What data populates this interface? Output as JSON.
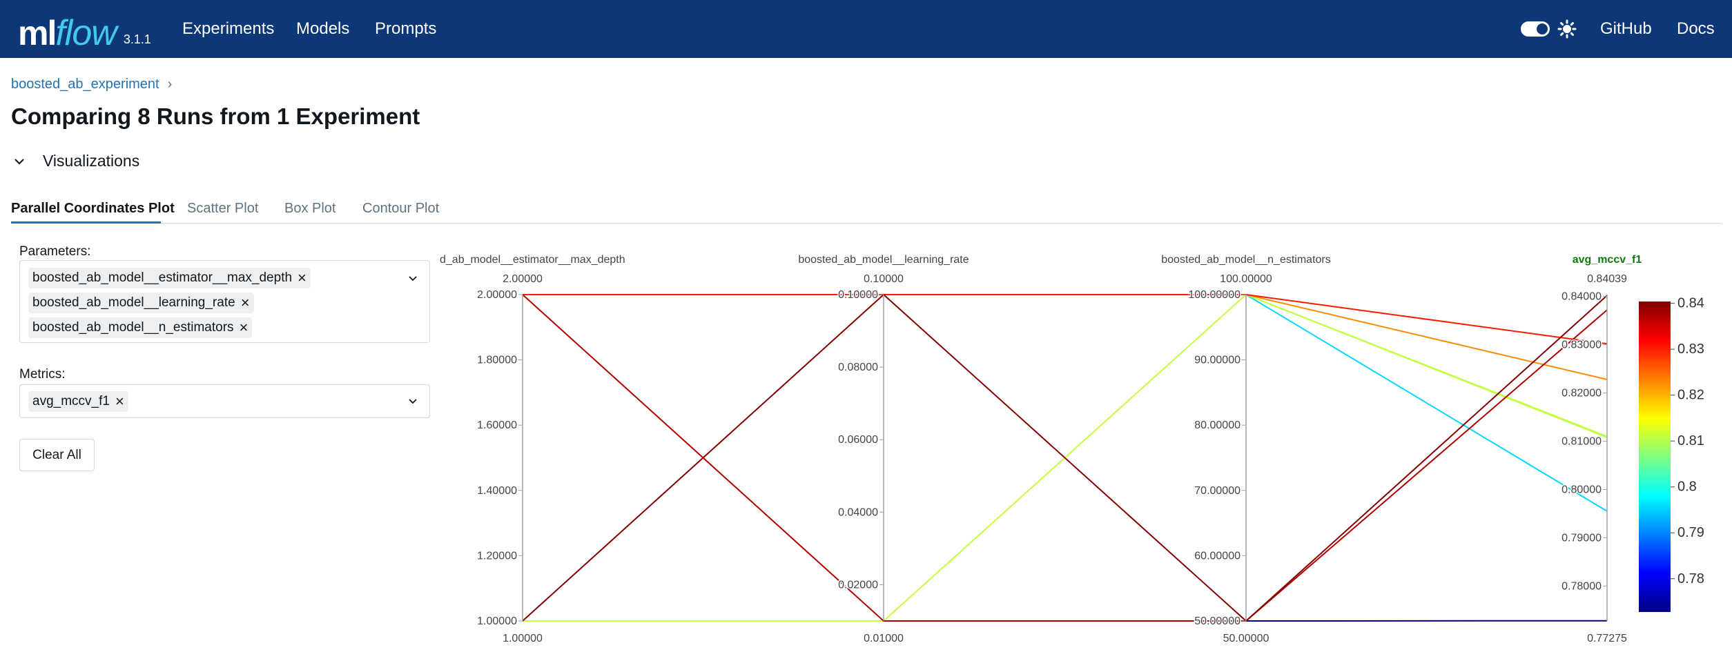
{
  "header": {
    "logo_main": "ml",
    "logo_accent": "flow",
    "version": "3.1.1",
    "nav": [
      "Experiments",
      "Models",
      "Prompts"
    ],
    "right_links": [
      "GitHub",
      "Docs"
    ],
    "colors": {
      "bar": "#0e3778",
      "accent": "#43c9ed"
    }
  },
  "breadcrumb": {
    "experiment": "boosted_ab_experiment",
    "separator": "›"
  },
  "page": {
    "title": "Comparing 8 Runs from 1 Experiment"
  },
  "section": {
    "title": "Visualizations"
  },
  "tabs": [
    "Parallel Coordinates Plot",
    "Scatter Plot",
    "Box Plot",
    "Contour Plot"
  ],
  "controls": {
    "parameters_label": "Parameters:",
    "parameters": [
      "boosted_ab_model__estimator__max_depth",
      "boosted_ab_model__learning_rate",
      "boosted_ab_model__n_estimators"
    ],
    "metrics_label": "Metrics:",
    "metrics": [
      "avg_mccv_f1"
    ],
    "clear_all": "Clear All"
  },
  "chart_data": {
    "type": "parallel_coordinates",
    "dimensions": [
      {
        "label": "d_ab_model__estimator__max_depth",
        "range": [
          1,
          2
        ],
        "top_label": "2.00000",
        "bottom_label": "1.00000",
        "ticks": [
          "2.00000",
          "1.80000",
          "1.60000",
          "1.40000",
          "1.20000",
          "1.00000"
        ]
      },
      {
        "label": "boosted_ab_model__learning_rate",
        "range": [
          0.01,
          0.1
        ],
        "top_label": "0.10000",
        "bottom_label": "0.01000",
        "ticks": [
          "0.10000",
          "0.08000",
          "0.06000",
          "0.04000",
          "0.02000"
        ]
      },
      {
        "label": "boosted_ab_model__n_estimators",
        "range": [
          50,
          100
        ],
        "top_label": "100.00000",
        "bottom_label": "50.00000",
        "ticks": [
          "100.00000",
          "90.00000",
          "80.00000",
          "70.00000",
          "60.00000",
          "50.00000"
        ]
      },
      {
        "label": "avg_mccv_f1",
        "range": [
          0.77275,
          0.84039
        ],
        "top_label": "0.84039",
        "bottom_label": "0.77275",
        "ticks": [
          "0.84000",
          "0.83000",
          "0.82000",
          "0.81000",
          "0.80000",
          "0.79000",
          "0.78000"
        ]
      }
    ],
    "runs": [
      [
        2,
        0.1,
        100,
        0.8302
      ],
      [
        2,
        0.1,
        100,
        0.8228
      ],
      [
        2,
        0.1,
        100,
        0.8108
      ],
      [
        2,
        0.1,
        100,
        0.7955
      ],
      [
        1,
        0.1,
        50,
        0.8402
      ],
      [
        2,
        0.01,
        50,
        0.8372
      ],
      [
        1,
        0.01,
        100,
        0.811
      ],
      [
        1,
        0.01,
        50,
        0.7728
      ]
    ],
    "colorbar": {
      "ticks": [
        "0.84",
        "0.83",
        "0.82",
        "0.81",
        "0.8",
        "0.79",
        "0.78"
      ],
      "colorscale": "jet"
    }
  }
}
